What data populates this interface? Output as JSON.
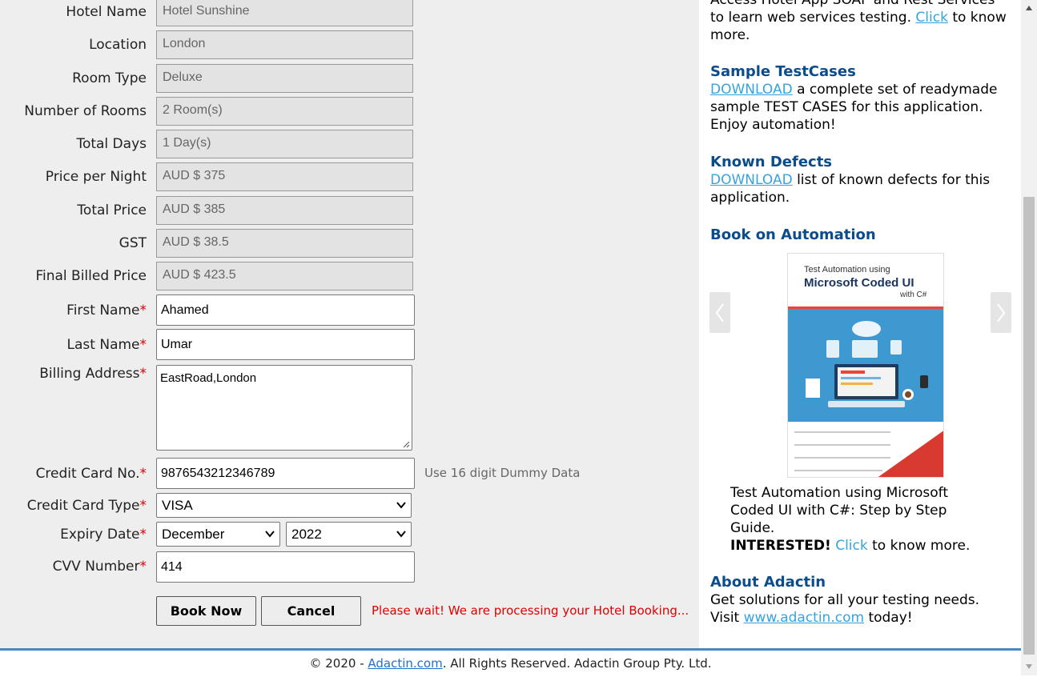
{
  "form": {
    "hotel_name": {
      "label": "Hotel Name",
      "value": "Hotel Sunshine"
    },
    "location": {
      "label": "Location",
      "value": "London"
    },
    "room_type": {
      "label": "Room Type",
      "value": "Deluxe"
    },
    "num_rooms": {
      "label": "Number of Rooms",
      "value": "2 Room(s)"
    },
    "total_days": {
      "label": "Total Days",
      "value": "1 Day(s)"
    },
    "price_per_night": {
      "label": "Price per Night",
      "value": "AUD $ 375"
    },
    "total_price": {
      "label": "Total Price",
      "value": "AUD $ 385"
    },
    "gst": {
      "label": "GST",
      "value": "AUD $ 38.5"
    },
    "final_price": {
      "label": "Final Billed Price",
      "value": "AUD $ 423.5"
    },
    "first_name": {
      "label": "First Name",
      "value": "Ahamed"
    },
    "last_name": {
      "label": "Last Name",
      "value": "Umar"
    },
    "billing_address": {
      "label": "Billing Address",
      "value": "EastRoad,London"
    },
    "cc_num": {
      "label": "Credit Card No.",
      "value": "9876543212346789",
      "hint": "Use 16 digit Dummy Data"
    },
    "cc_type": {
      "label": "Credit Card Type",
      "value": "VISA"
    },
    "expiry": {
      "label": "Expiry Date",
      "month": "December",
      "year": "2022"
    },
    "cvv": {
      "label": "CVV Number",
      "value": "414"
    },
    "required_mark": "*",
    "book_now_label": "Book Now",
    "cancel_label": "Cancel",
    "processing_msg": "Please wait! We are processing your Hotel Booking..."
  },
  "sidebar": {
    "soap": {
      "text": "Access Hotel App SOAP and Rest Services to learn web services testing.",
      "link": "Click",
      "tail": "to know more."
    },
    "sample": {
      "heading": "Sample TestCases",
      "link": "DOWNLOAD",
      "text": "a complete set of readymade sample TEST CASES for this application. Enjoy automation!"
    },
    "defects": {
      "heading": "Known Defects",
      "link": "DOWNLOAD",
      "text": "list of known defects for this application."
    },
    "book": {
      "heading": "Book on Automation",
      "cover_subtitle": "Test Automation using",
      "cover_title": "Microsoft Coded UI",
      "cover_with": "with C#",
      "caption": "Test Automation using Microsoft Coded UI with C#: Step by Step Guide.",
      "interested": "INTERESTED!",
      "link": "Click",
      "tail": "to know more."
    },
    "about": {
      "heading": "About Adactin",
      "line1": "Get solutions for all your testing needs.",
      "visit": "Visit",
      "link": "www.adactin.com",
      "tail": "today!"
    }
  },
  "footer": {
    "prefix": "© 2020 -",
    "link": "Adactin.com",
    "suffix": ". All Rights Reserved. Adactin Group Pty. Ltd."
  },
  "colors": {
    "heading": "#0b4c8c",
    "link": "#36a3e0",
    "required": "#dd0000",
    "processing": "#e00000",
    "footer_rule": "#4d87c0"
  }
}
